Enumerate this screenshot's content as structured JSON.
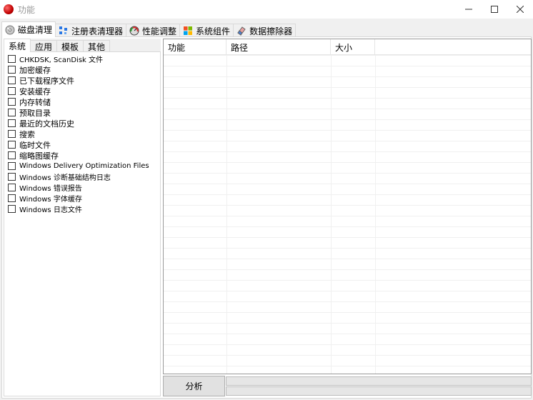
{
  "window": {
    "title": "功能"
  },
  "top_tabs": [
    {
      "label": "磁盘清理",
      "icon": "disk-cleanup-icon",
      "active": true
    },
    {
      "label": "注册表清理器",
      "icon": "registry-icon",
      "active": false
    },
    {
      "label": "性能调整",
      "icon": "performance-icon",
      "active": false
    },
    {
      "label": "系统组件",
      "icon": "windows-icon",
      "active": false
    },
    {
      "label": "数据擦除器",
      "icon": "eraser-icon",
      "active": false
    }
  ],
  "sub_tabs": [
    {
      "label": "系统",
      "active": true
    },
    {
      "label": "应用",
      "active": false
    },
    {
      "label": "模板",
      "active": false
    },
    {
      "label": "其他",
      "active": false
    }
  ],
  "items": [
    {
      "label": "CHKDSK, ScanDisk 文件",
      "checked": false
    },
    {
      "label": "加密缓存",
      "checked": false
    },
    {
      "label": "已下载程序文件",
      "checked": false
    },
    {
      "label": "安装缓存",
      "checked": false
    },
    {
      "label": "内存转储",
      "checked": false
    },
    {
      "label": "预取目录",
      "checked": false
    },
    {
      "label": "最近的文档历史",
      "checked": false
    },
    {
      "label": "搜索",
      "checked": false
    },
    {
      "label": "临时文件",
      "checked": false
    },
    {
      "label": "缩略图缓存",
      "checked": false
    },
    {
      "label": "Windows Delivery Optimization Files",
      "checked": false
    },
    {
      "label": "Windows 诊断基础结构日志",
      "checked": false
    },
    {
      "label": "Windows 错误报告",
      "checked": false
    },
    {
      "label": "Windows 字体缓存",
      "checked": false
    },
    {
      "label": "Windows 日志文件",
      "checked": false
    }
  ],
  "results_table": {
    "columns": [
      "功能",
      "路径",
      "大小",
      ""
    ],
    "rows": []
  },
  "analyze_button": {
    "label": "分析"
  },
  "progress": {
    "primary": 0,
    "secondary": 0
  },
  "colors": {
    "progress_fill": "#06b025",
    "app_icon": "#c00000"
  }
}
